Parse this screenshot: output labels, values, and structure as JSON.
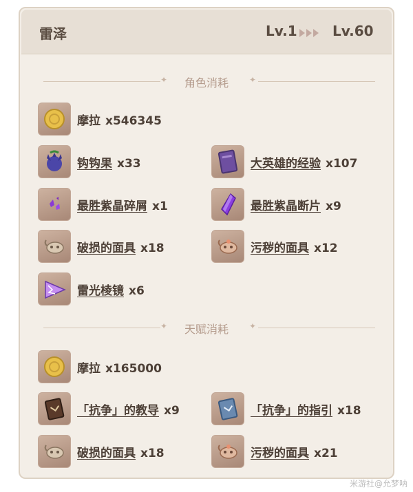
{
  "header": {
    "character": "雷泽",
    "level_from": "Lv.1",
    "level_to": "Lv.60"
  },
  "sections": [
    {
      "title": "角色消耗",
      "items": [
        {
          "name": "摩拉",
          "qty": "x546345",
          "icon": "mora-coin-icon",
          "link": false
        },
        {
          "name": "钩钩果",
          "qty": "x33",
          "icon": "wolfhook-icon",
          "link": true
        },
        {
          "name": "大英雄的经验",
          "qty": "x107",
          "icon": "heros-wit-book-icon",
          "link": true
        },
        {
          "name": "最胜紫晶碎屑",
          "qty": "x1",
          "icon": "vajrada-amethyst-sliver-icon",
          "link": true
        },
        {
          "name": "最胜紫晶断片",
          "qty": "x9",
          "icon": "vajrada-amethyst-fragment-icon",
          "link": true
        },
        {
          "name": "破损的面具",
          "qty": "x18",
          "icon": "damaged-mask-icon",
          "link": true
        },
        {
          "name": "污秽的面具",
          "qty": "x12",
          "icon": "stained-mask-icon",
          "link": true
        },
        {
          "name": "雷光棱镜",
          "qty": "x6",
          "icon": "lightning-prism-icon",
          "link": true
        }
      ]
    },
    {
      "title": "天赋消耗",
      "items": [
        {
          "name": "摩拉",
          "qty": "x165000",
          "icon": "mora-coin-icon",
          "link": false
        },
        {
          "name": "「抗争」的教导",
          "qty": "x9",
          "icon": "teachings-of-resistance-icon",
          "link": true
        },
        {
          "name": "「抗争」的指引",
          "qty": "x18",
          "icon": "guide-to-resistance-icon",
          "link": true
        },
        {
          "name": "破损的面具",
          "qty": "x18",
          "icon": "damaged-mask-icon",
          "link": true
        },
        {
          "name": "污秽的面具",
          "qty": "x21",
          "icon": "stained-mask-icon",
          "link": true
        }
      ]
    }
  ],
  "watermark": "米游社@允梦呐",
  "colors": {
    "card_bg": "#f3eee7",
    "header_bg": "#e7dfd5",
    "text": "#4d4037",
    "section_title": "#b49b8c",
    "icon_bg": "#bf9f8d"
  }
}
